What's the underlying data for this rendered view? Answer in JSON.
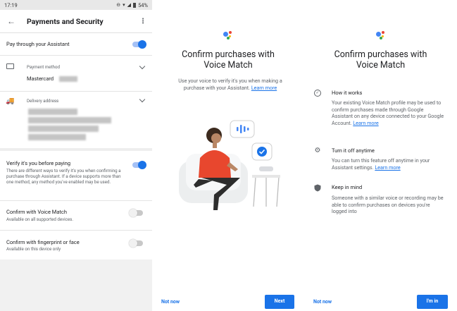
{
  "panel1": {
    "status": {
      "time": "17:19",
      "battery": "54%"
    },
    "header": {
      "title": "Payments and Security"
    },
    "pay_through": {
      "label": "Pay through your Assistant",
      "enabled": true
    },
    "payment_method": {
      "label": "Payment method",
      "value": "Mastercard"
    },
    "delivery": {
      "label": "Delivery address"
    },
    "verify": {
      "label": "Verify it's you before paying",
      "desc": "There are different ways to verify it's you when confirming a purchase through Assistant. If a device supports more than one method, any method you've enabled may be used.",
      "enabled": true
    },
    "voice_match": {
      "label": "Confirm with Voice Match",
      "desc": "Available on all supported devices.",
      "enabled": false
    },
    "fingerprint": {
      "label": "Confirm with fingerprint or face",
      "desc": "Available on this device only",
      "enabled": false
    }
  },
  "panel2": {
    "title_line1": "Confirm purchases with",
    "title_line2": "Voice Match",
    "desc": "Use your voice to verify it's you when making a purchase with your Assistant.",
    "learn_more": "Learn more",
    "not_now": "Not now",
    "next": "Next"
  },
  "panel3": {
    "title_line1": "Confirm purchases with",
    "title_line2": "Voice Match",
    "features": [
      {
        "icon": "check-circle-icon",
        "title": "How it works",
        "body": "Your existing Voice Match profile may be used to confirm purchases made through Google Assistant on any device connected to your Google Account.",
        "link": "Learn more"
      },
      {
        "icon": "gear-icon",
        "title": "Turn it off anytime",
        "body": "You can turn this feature off anytime in your Assistant settings.",
        "link": "Learn more"
      },
      {
        "icon": "shield-icon",
        "title": "Keep in mind",
        "body": "Someone with a similar voice or recording may be able to confirm purchases on devices you're logged into",
        "link": ""
      }
    ],
    "not_now": "Not now",
    "im_in": "I'm in"
  },
  "colors": {
    "accent": "#1a73e8",
    "google_blue": "#4285f4",
    "google_red": "#ea4335",
    "google_yellow": "#fbbc04",
    "google_green": "#34a853",
    "person_shirt": "#e8472e"
  }
}
